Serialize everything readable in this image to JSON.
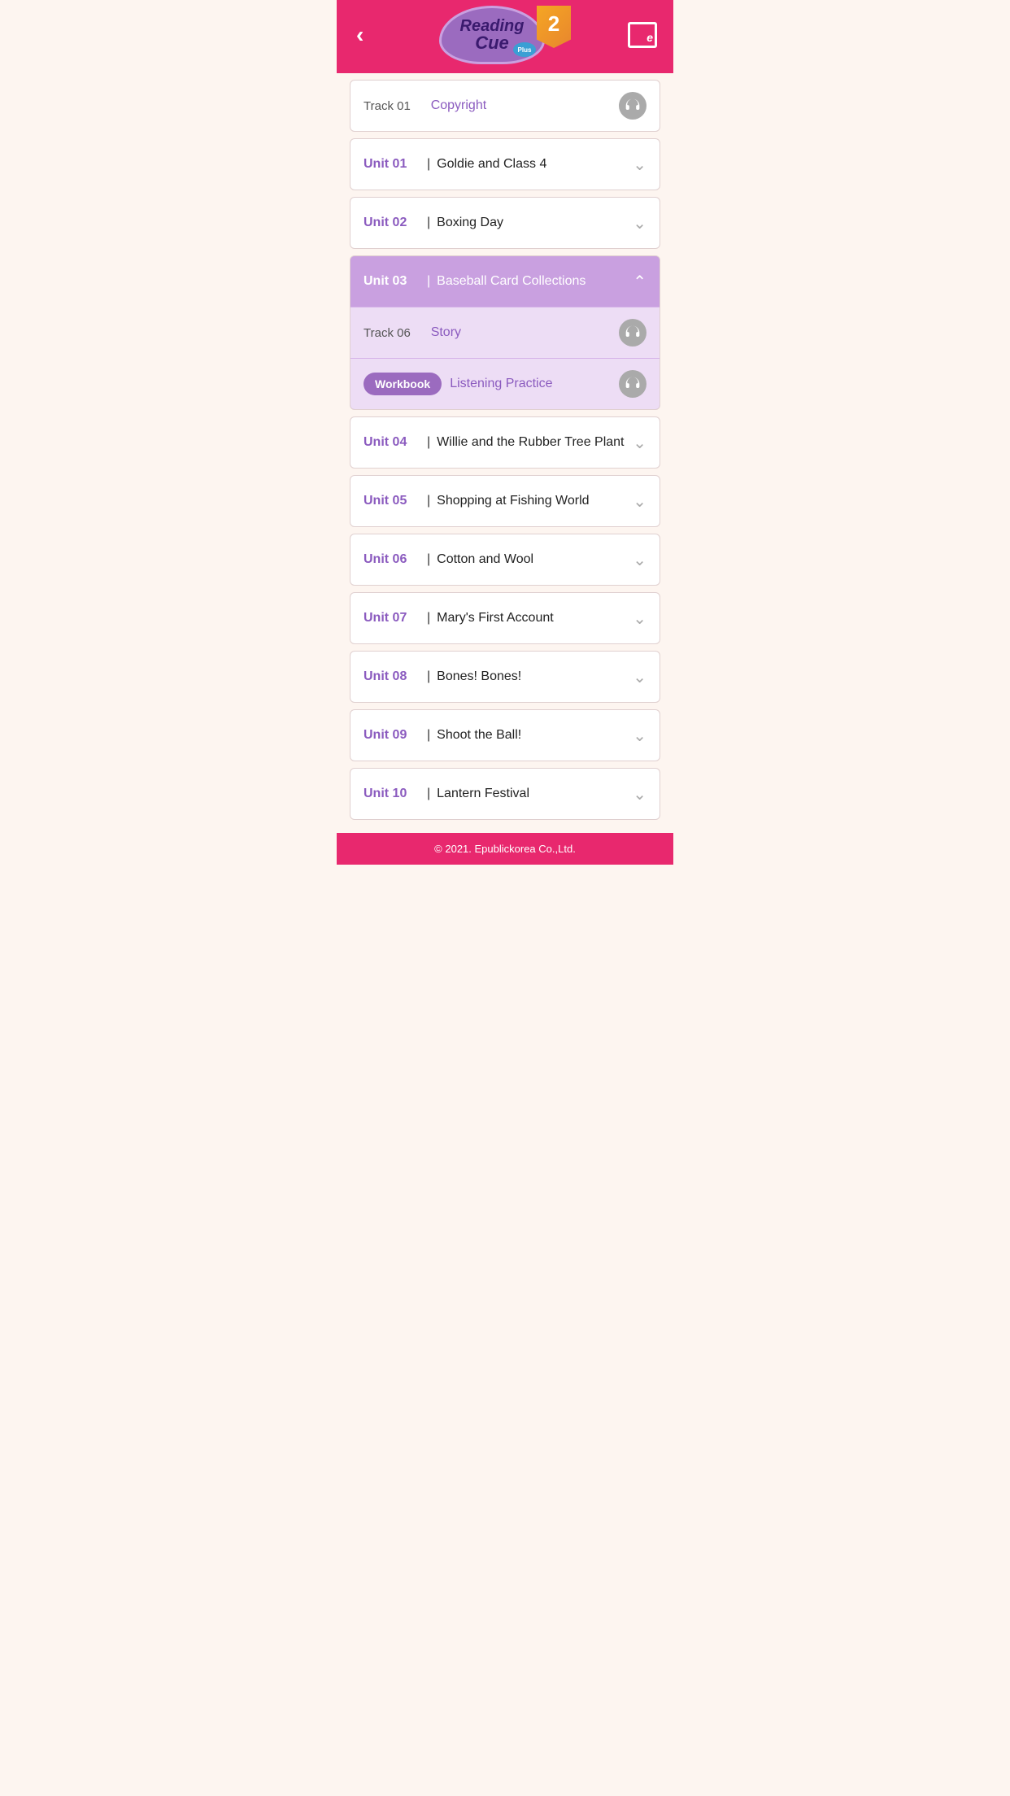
{
  "header": {
    "back_label": "‹",
    "logo_reading": "Reading",
    "logo_cue": "Cue",
    "logo_plus": "Plus",
    "level": "2",
    "ebook_label": "e"
  },
  "track_01": {
    "track_label": "Track 01",
    "title": "Copyright",
    "icon": "headphone"
  },
  "units": [
    {
      "id": "unit-01",
      "unit_label": "Unit 01",
      "divider": "|",
      "title": "Goldie and Class 4",
      "expanded": false
    },
    {
      "id": "unit-02",
      "unit_label": "Unit 02",
      "divider": "|",
      "title": "Boxing Day",
      "expanded": false
    },
    {
      "id": "unit-03",
      "unit_label": "Unit 03",
      "divider": "|",
      "title": "Baseball Card Collections",
      "expanded": true,
      "sub_items": [
        {
          "track_label": "Track 06",
          "title": "Story",
          "icon": "headphone"
        },
        {
          "workbook_label": "Workbook",
          "title": "Listening Practice",
          "icon": "headphone"
        }
      ]
    },
    {
      "id": "unit-04",
      "unit_label": "Unit 04",
      "divider": "|",
      "title": "Willie and the Rubber Tree Plant",
      "expanded": false
    },
    {
      "id": "unit-05",
      "unit_label": "Unit 05",
      "divider": "|",
      "title": "Shopping at Fishing World",
      "expanded": false
    },
    {
      "id": "unit-06",
      "unit_label": "Unit 06",
      "divider": "|",
      "title": "Cotton and Wool",
      "expanded": false
    },
    {
      "id": "unit-07",
      "unit_label": "Unit 07",
      "divider": "|",
      "title": "Mary's First Account",
      "expanded": false
    },
    {
      "id": "unit-08",
      "unit_label": "Unit 08",
      "divider": "|",
      "title": "Bones! Bones!",
      "expanded": false
    },
    {
      "id": "unit-09",
      "unit_label": "Unit 09",
      "divider": "|",
      "title": "Shoot the Ball!",
      "expanded": false
    },
    {
      "id": "unit-10",
      "unit_label": "Unit 10",
      "divider": "|",
      "title": "Lantern Festival",
      "expanded": false
    }
  ],
  "footer": {
    "text": "© 2021. Epublickorea Co.,Ltd."
  }
}
